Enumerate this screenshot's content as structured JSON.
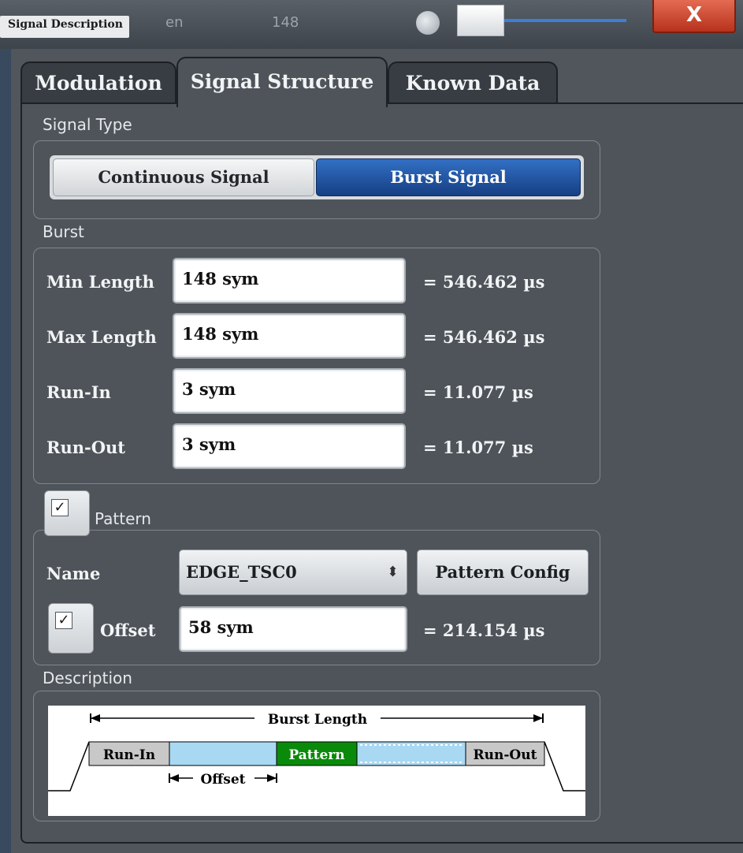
{
  "window": {
    "title": "Signal Description",
    "close_label": "X",
    "background_text": "en",
    "background_value": "148"
  },
  "tabs": [
    {
      "label": "Modulation",
      "active": false
    },
    {
      "label": "Signal Structure",
      "active": true
    },
    {
      "label": "Known Data",
      "active": false
    }
  ],
  "signal_type": {
    "section_label": "Signal Type",
    "options": [
      "Continuous Signal",
      "Burst Signal"
    ],
    "selected": "Burst Signal"
  },
  "burst": {
    "section_label": "Burst",
    "rows": [
      {
        "label": "Min Length",
        "value": "148 sym",
        "equivalent": "= 546.462 µs"
      },
      {
        "label": "Max Length",
        "value": "148 sym",
        "equivalent": "= 546.462 µs"
      },
      {
        "label": "Run-In",
        "value": "3 sym",
        "equivalent": "= 11.077 µs"
      },
      {
        "label": "Run-Out",
        "value": "3 sym",
        "equivalent": "= 11.077 µs"
      }
    ]
  },
  "pattern": {
    "enabled": true,
    "section_label": "Pattern",
    "name_label": "Name",
    "name_value": "EDGE_TSC0",
    "config_button": "Pattern Config",
    "offset_enabled": true,
    "offset_label": "Offset",
    "offset_value": "58 sym",
    "offset_equivalent": "= 214.154 µs",
    "check_mark": "✓"
  },
  "description": {
    "section_label": "Description",
    "diagram": {
      "burst_length": "Burst Length",
      "run_in": "Run-In",
      "pattern": "Pattern",
      "run_out": "Run-Out",
      "offset": "Offset"
    }
  },
  "colors": {
    "accent_blue": "#1f4f9e",
    "pattern_green": "#0a8a0a",
    "burst_fill": "#a9d8f3",
    "runin_fill": "#c8c8c8"
  }
}
